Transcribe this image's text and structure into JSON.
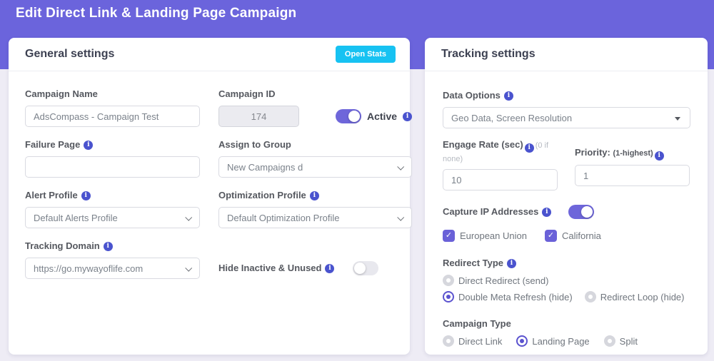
{
  "header": {
    "title": "Edit Direct Link & Landing Page Campaign"
  },
  "general": {
    "title": "General settings",
    "open_stats_button": "Open Stats",
    "campaign_name": {
      "label": "Campaign Name",
      "value": "AdsCompass - Campaign Test"
    },
    "campaign_id": {
      "label": "Campaign ID",
      "value": "174"
    },
    "active_toggle": {
      "label": "Active",
      "state": "on"
    },
    "failure_page": {
      "label": "Failure Page",
      "value": ""
    },
    "assign_to_group": {
      "label": "Assign to Group",
      "value": "New Campaigns d"
    },
    "alert_profile": {
      "label": "Alert Profile",
      "value": "Default Alerts Profile"
    },
    "optimization_profile": {
      "label": "Optimization Profile",
      "value": "Default Optimization Profile"
    },
    "tracking_domain": {
      "label": "Tracking Domain",
      "value": "https://go.mywayoflife.com"
    },
    "hide_inactive": {
      "label": "Hide Inactive & Unused",
      "state": "off"
    }
  },
  "tracking": {
    "title": "Tracking settings",
    "data_options": {
      "label": "Data Options",
      "value": "Geo Data, Screen Resolution"
    },
    "engage_rate": {
      "label": "Engage Rate (sec)",
      "hint": "(0 if none)",
      "value": "10"
    },
    "priority": {
      "label": "Priority:",
      "hint": "(1-highest)",
      "value": "1"
    },
    "capture_ip": {
      "label": "Capture IP Addresses",
      "state": "on"
    },
    "ip_checkboxes": [
      {
        "label": "European Union",
        "checked": true
      },
      {
        "label": "California",
        "checked": true
      }
    ],
    "redirect_type": {
      "label": "Redirect Type",
      "options": [
        {
          "label": "Direct Redirect (send)",
          "selected": false
        },
        {
          "label": "Double Meta Refresh (hide)",
          "selected": true
        },
        {
          "label": "Redirect Loop (hide)",
          "selected": false
        }
      ]
    },
    "campaign_type": {
      "label": "Campaign Type",
      "options": [
        {
          "label": "Direct Link",
          "selected": false
        },
        {
          "label": "Landing Page",
          "selected": true
        },
        {
          "label": "Split",
          "selected": false
        }
      ]
    }
  },
  "colors": {
    "header_purple": "#6b64dc",
    "accent_purple": "#6a61d8",
    "cyan_button": "#17c2f2",
    "info_icon": "#4a53ce",
    "page_bg": "#eeecf5"
  }
}
